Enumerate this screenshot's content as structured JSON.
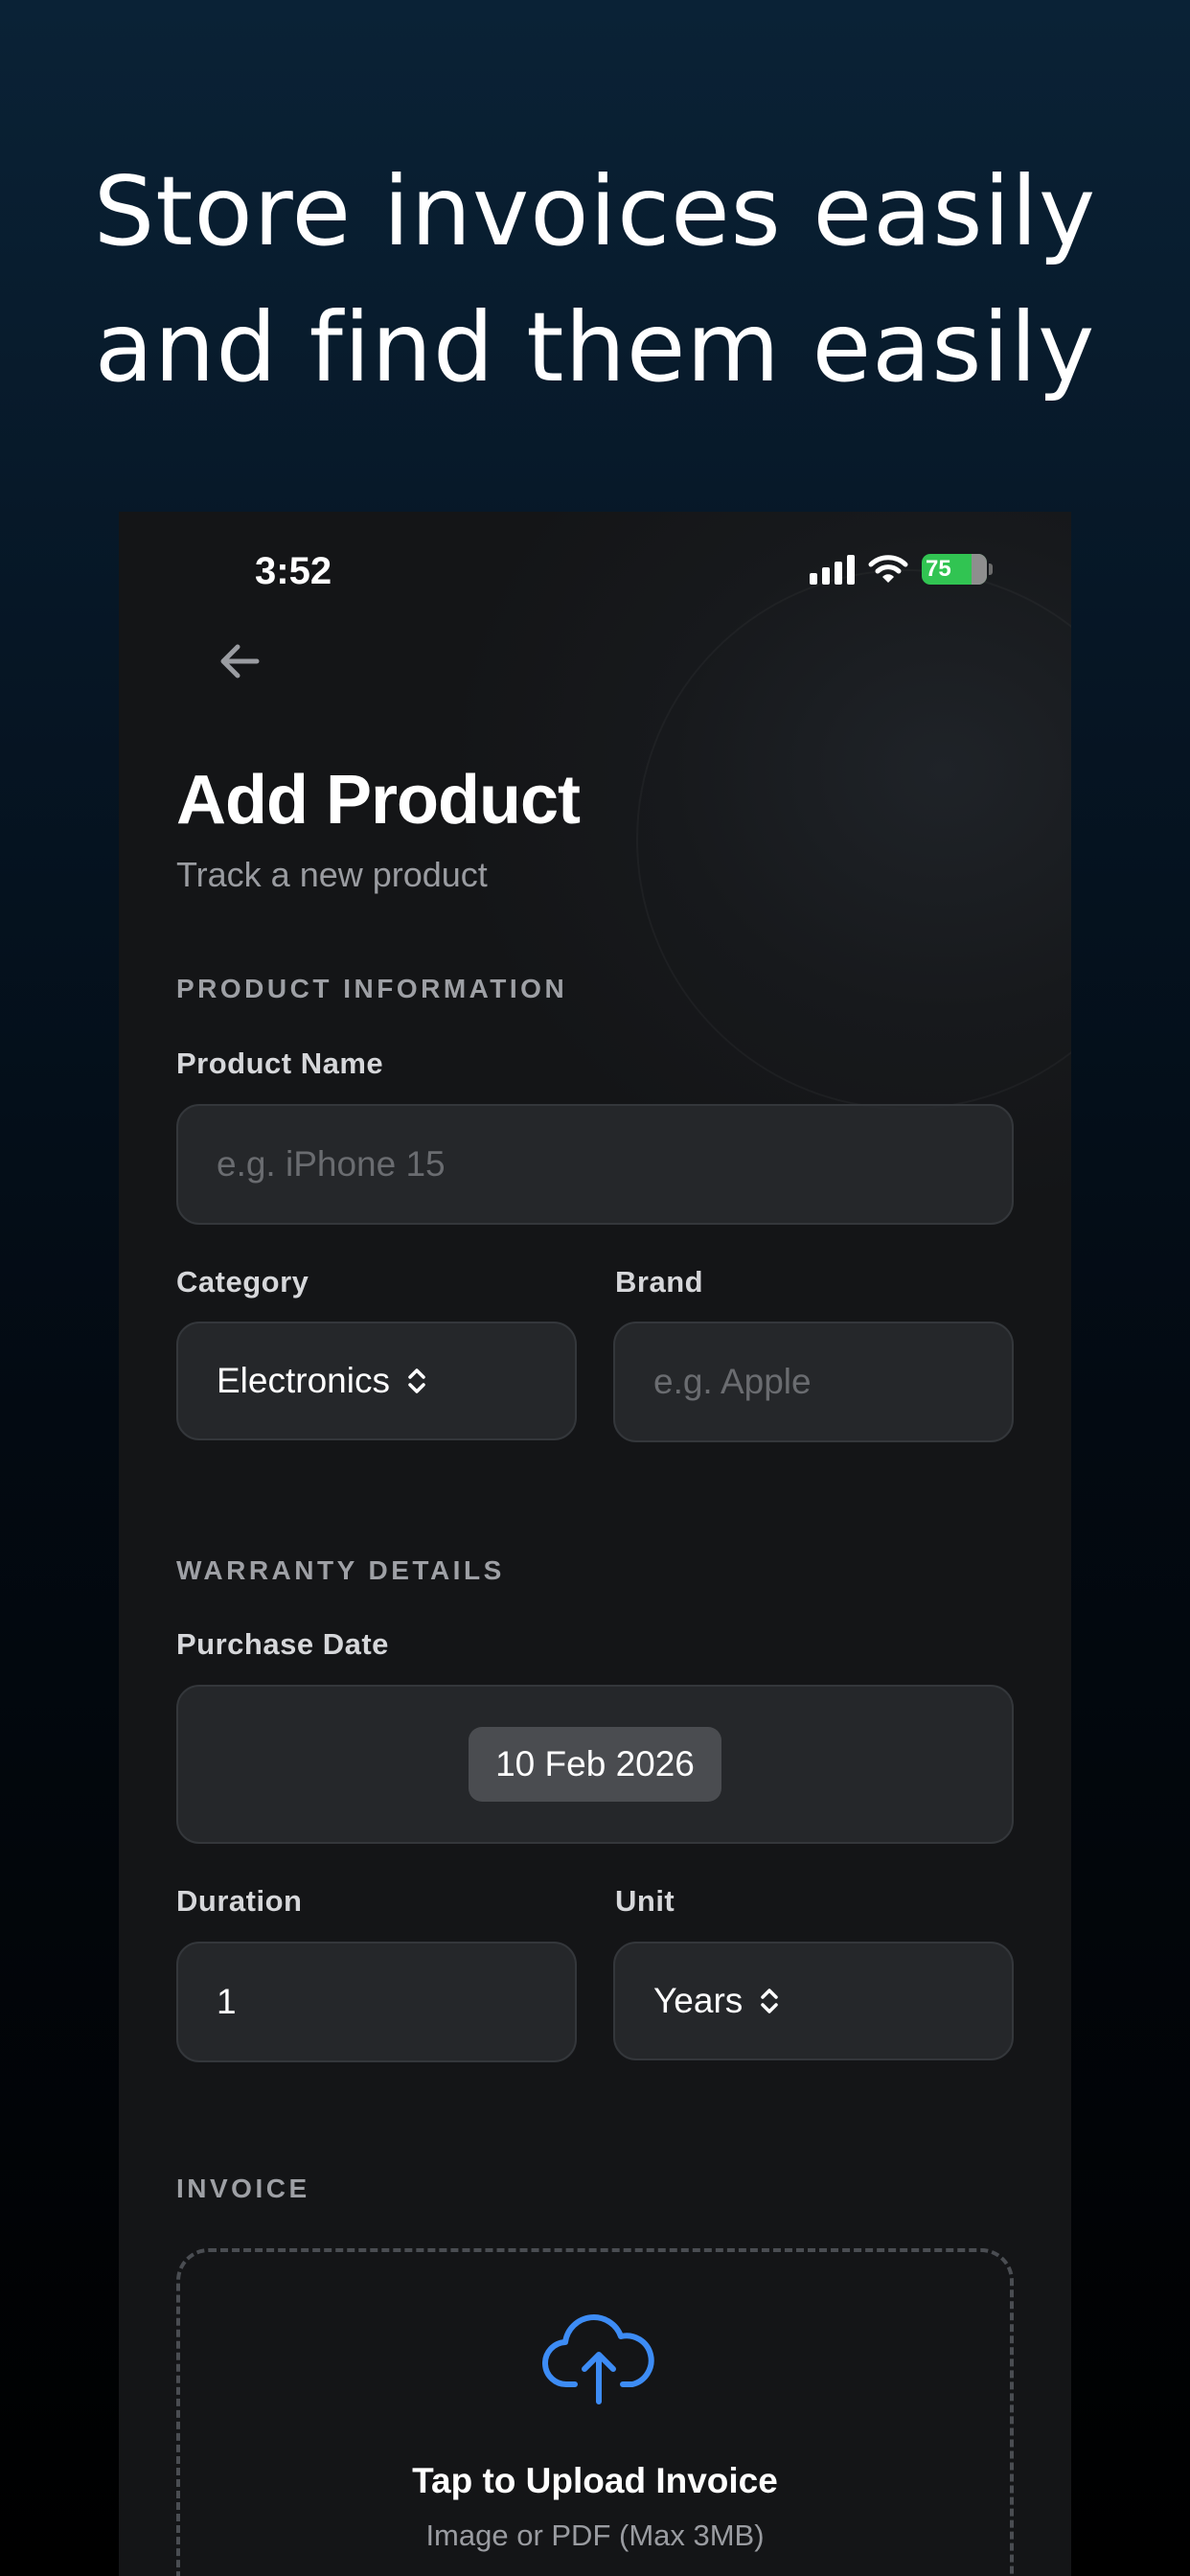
{
  "headline": {
    "line1": "Store invoices easily",
    "line2": "and find them easily"
  },
  "status_bar": {
    "time": "3:52",
    "battery": "75",
    "battery_color": "#31c452"
  },
  "header": {
    "back_icon": "arrow-left-icon",
    "title": "Add Product",
    "subtitle": "Track a new product"
  },
  "product_information": {
    "section_label": "PRODUCT INFORMATION",
    "product_name": {
      "label": "Product Name",
      "placeholder": "e.g. iPhone 15"
    },
    "category": {
      "label": "Category",
      "value": "Electronics",
      "icon": "chevron-updown-icon"
    },
    "brand": {
      "label": "Brand",
      "placeholder": "e.g. Apple"
    }
  },
  "warranty_details": {
    "section_label": "WARRANTY DETAILS",
    "purchase_date": {
      "label": "Purchase Date",
      "value": "10 Feb 2026"
    },
    "duration": {
      "label": "Duration",
      "value": "1"
    },
    "unit": {
      "label": "Unit",
      "value": "Years",
      "icon": "chevron-updown-icon"
    }
  },
  "invoice": {
    "section_label": "INVOICE",
    "upload_icon": "cloud-upload-icon",
    "upload_icon_color": "#3d8cf5",
    "upload_title": "Tap to Upload Invoice",
    "upload_subtitle": "Image or PDF (Max 3MB)"
  }
}
